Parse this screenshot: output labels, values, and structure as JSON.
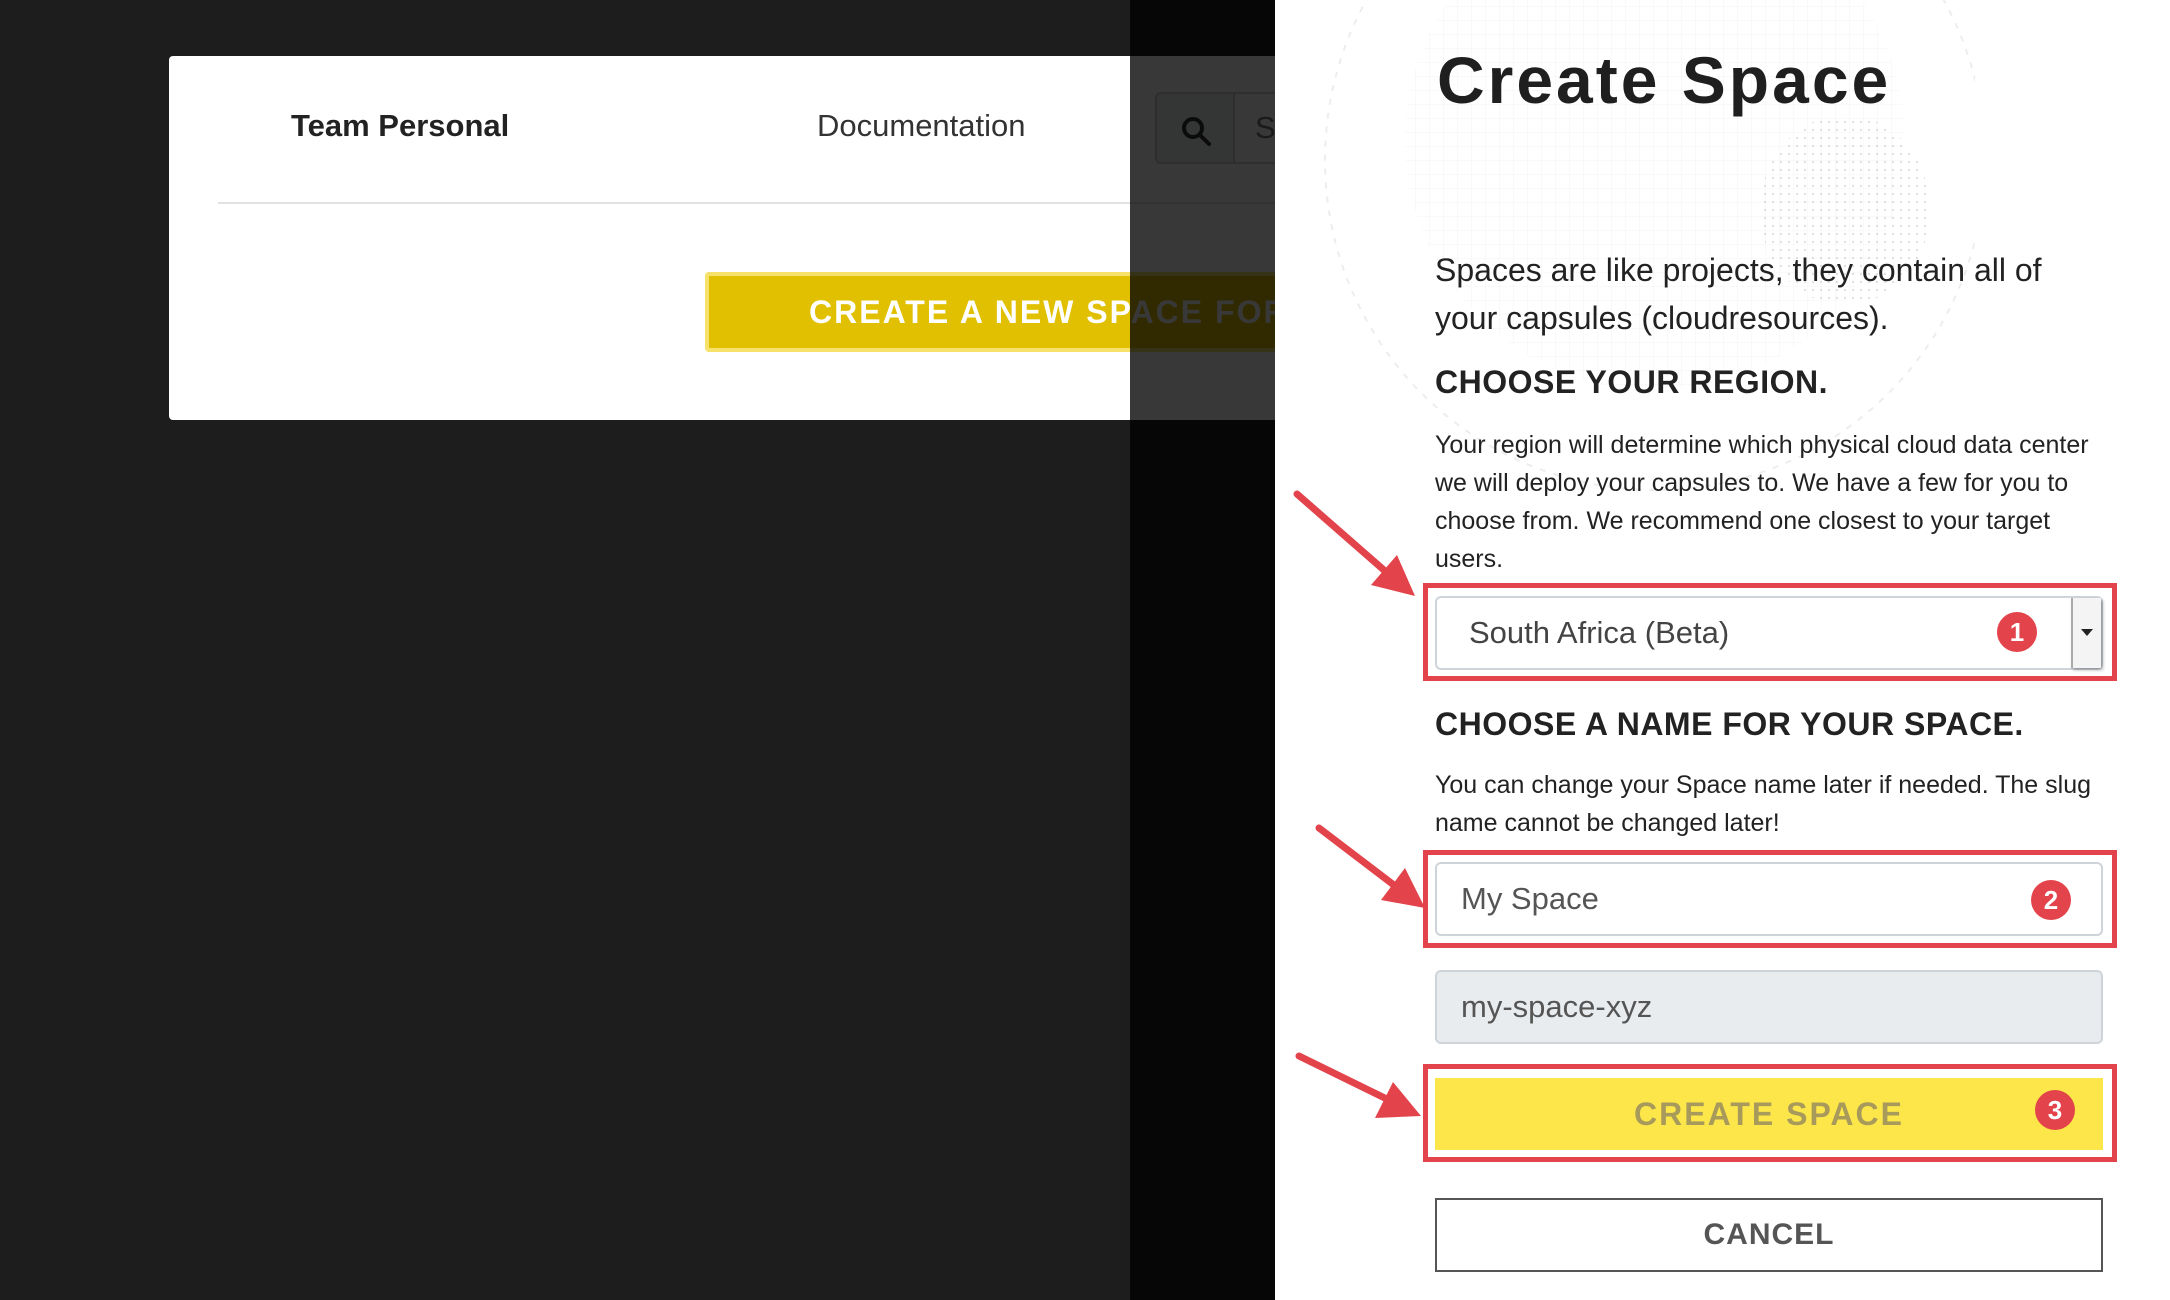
{
  "background_app": {
    "team_name": "Team Personal",
    "documentation_link": "Documentation",
    "search_placeholder": "Search",
    "create_new_space_button": "CREATE A NEW SPACE FOR YOU"
  },
  "panel": {
    "title": "Create Space",
    "intro": "Spaces are like projects, they contain all of your capsules (cloudresources).",
    "region_heading": "CHOOSE YOUR REGION.",
    "region_help": "Your region will determine which physical cloud data center we will deploy your capsules to. We have a few for you to choose from. We recommend one closest to your target users.",
    "region_selected": "South Africa (Beta)",
    "name_heading": "CHOOSE A NAME FOR YOUR SPACE.",
    "name_help": "You can change your Space name later if needed. The slug name cannot be changed later!",
    "space_name_value": "My Space",
    "slug_value": "my-space-xyz",
    "create_button": "CREATE SPACE",
    "cancel_button": "CANCEL"
  },
  "annotations": {
    "step1": "1",
    "step2": "2",
    "step3": "3",
    "color": "#e3434a"
  },
  "colors": {
    "accent_yellow": "#fde64a",
    "dark_bg": "#1d1d1d"
  }
}
